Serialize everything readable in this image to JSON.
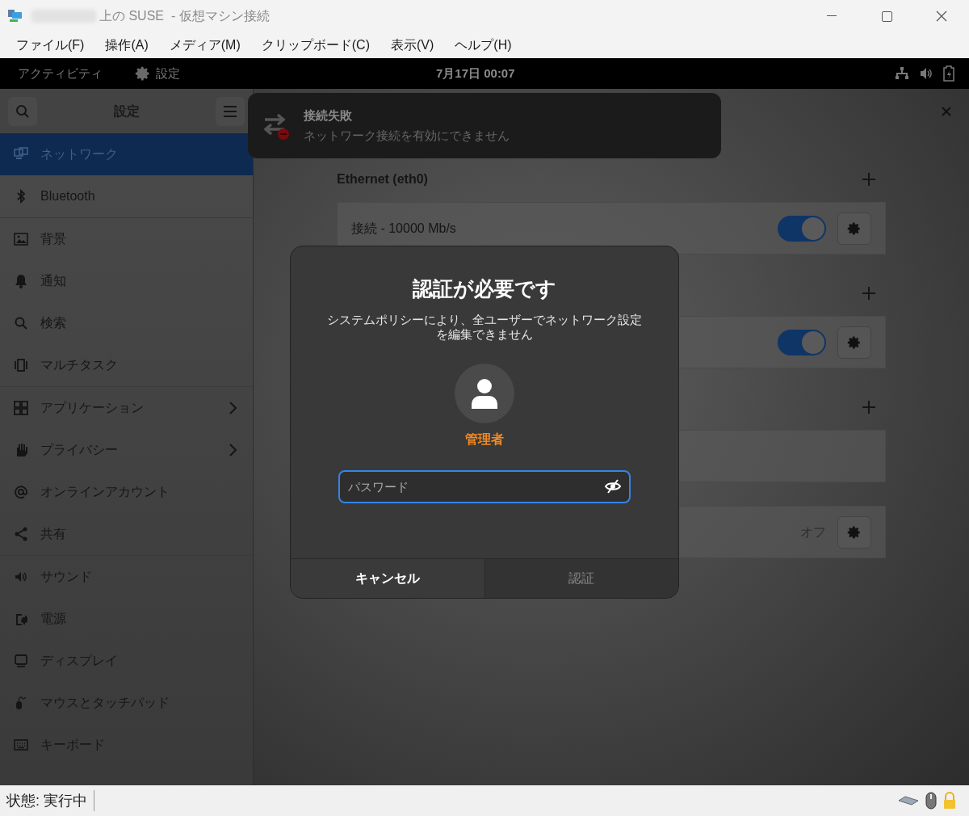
{
  "window": {
    "title": "上の SUSE  - 仮想マシン接続"
  },
  "menu": [
    "ファイル(F)",
    "操作(A)",
    "メディア(M)",
    "クリップボード(C)",
    "表示(V)",
    "ヘルプ(H)"
  ],
  "top_bar": {
    "activities": "アクティビティ",
    "app": "設定",
    "clock": "7月17日 00:07"
  },
  "sidebar": {
    "title": "設定",
    "groups": [
      [
        {
          "label": "ネットワーク",
          "selected": true,
          "submenu": false
        },
        {
          "label": "Bluetooth",
          "selected": false,
          "submenu": false
        }
      ],
      [
        {
          "label": "背景",
          "selected": false,
          "submenu": false
        },
        {
          "label": "通知",
          "selected": false,
          "submenu": false
        },
        {
          "label": "検索",
          "selected": false,
          "submenu": false
        },
        {
          "label": "マルチタスク",
          "selected": false,
          "submenu": false
        }
      ],
      [
        {
          "label": "アプリケーション",
          "selected": false,
          "submenu": true
        },
        {
          "label": "プライバシー",
          "selected": false,
          "submenu": true
        },
        {
          "label": "オンラインアカウント",
          "selected": false,
          "submenu": false
        },
        {
          "label": "共有",
          "selected": false,
          "submenu": false
        }
      ],
      [
        {
          "label": "サウンド",
          "selected": false,
          "submenu": false
        },
        {
          "label": "電源",
          "selected": false,
          "submenu": false
        },
        {
          "label": "ディスプレイ",
          "selected": false,
          "submenu": false
        },
        {
          "label": "マウスとタッチパッド",
          "selected": false,
          "submenu": false
        },
        {
          "label": "キーボード",
          "selected": false,
          "submenu": false
        }
      ]
    ]
  },
  "sections": [
    {
      "heading": "Ethernet (eth0)",
      "addable": true,
      "cards": [
        {
          "kind": "toggle",
          "label": "接続 - 10000 Mb/s",
          "on": true
        }
      ]
    },
    {
      "addable": true,
      "cards": [
        {
          "kind": "toggle",
          "on": true
        }
      ]
    },
    {
      "addable": true,
      "cards": [
        {
          "kind": "blank"
        }
      ]
    },
    {
      "addable": false,
      "cards": [
        {
          "kind": "status",
          "value": "オフ"
        }
      ]
    }
  ],
  "notification": {
    "title": "接続失敗",
    "body": "ネットワーク接続を有効にできません"
  },
  "dialog": {
    "title": "認証が必要です",
    "message": "システムポリシーにより、全ユーザーでネットワーク設定を編集できません",
    "user": "管理者",
    "password": {
      "placeholder": "パスワード"
    },
    "buttons": [
      {
        "label": "キャンセル",
        "disabled": false
      },
      {
        "label": "認証",
        "disabled": true
      }
    ]
  },
  "status_bar": {
    "state": "状態: 実行中"
  }
}
